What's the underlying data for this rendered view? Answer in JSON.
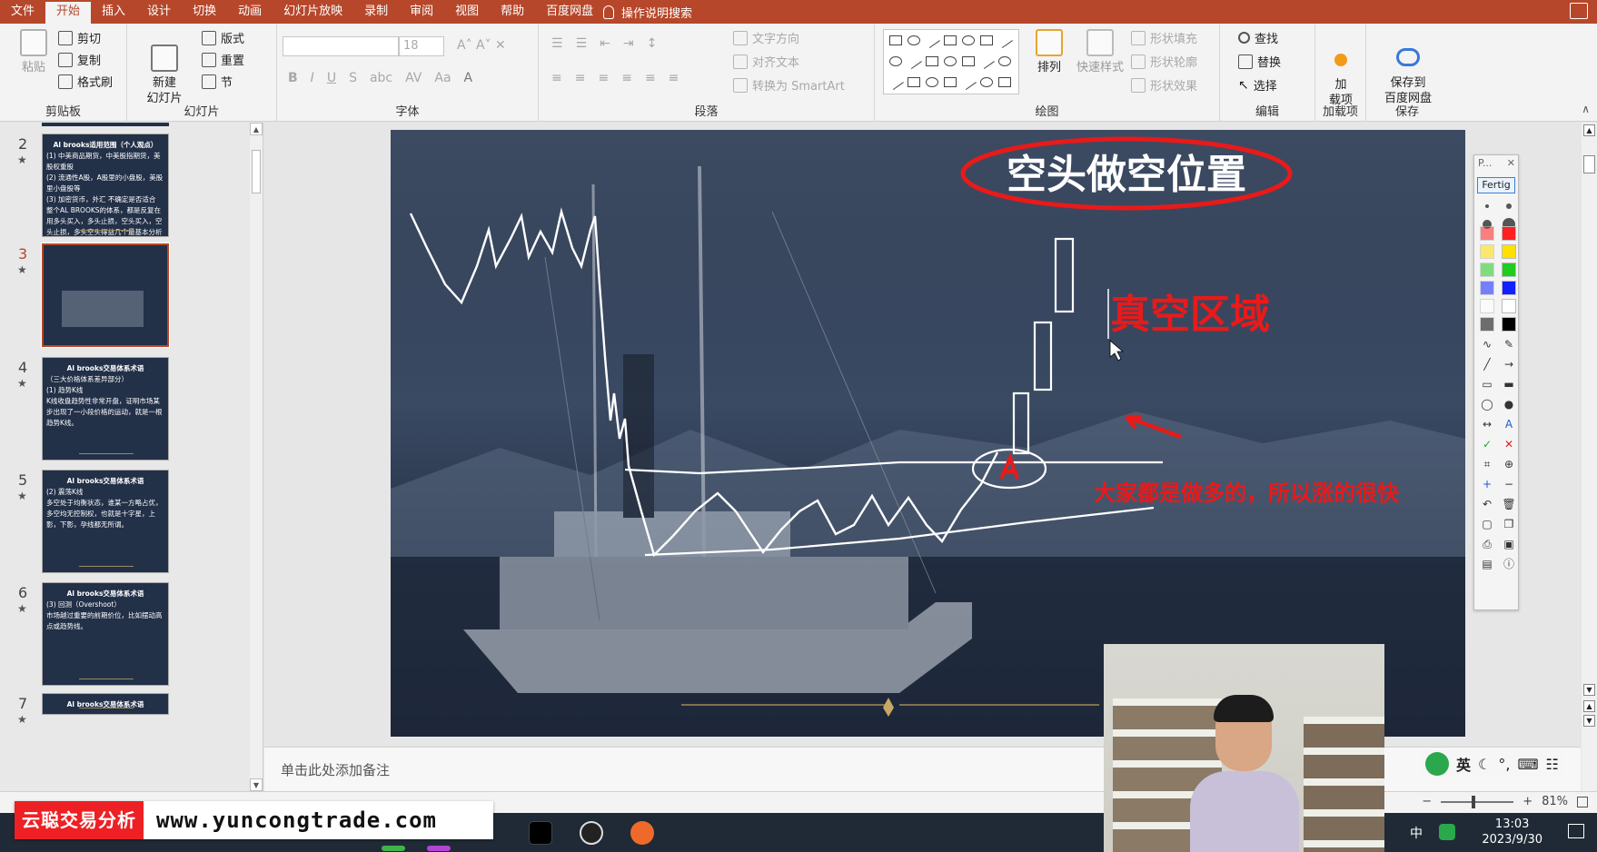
{
  "menu": {
    "tabs": [
      "文件",
      "开始",
      "插入",
      "设计",
      "切换",
      "动画",
      "幻灯片放映",
      "录制",
      "审阅",
      "视图",
      "帮助",
      "百度网盘"
    ],
    "active_tab": "开始",
    "tell_me": "操作说明搜索"
  },
  "ribbon": {
    "clipboard": {
      "paste": "粘贴",
      "cut": "剪切",
      "copy": "复制",
      "format_painter": "格式刷",
      "label": "剪贴板"
    },
    "slides": {
      "new_slide": "新建\n幻灯片",
      "layout": "版式",
      "reset": "重置",
      "section": "节",
      "label": "幻灯片"
    },
    "font": {
      "size": "18",
      "label": "字体"
    },
    "paragraph": {
      "text_direction": "文字方向",
      "align_text": "对齐文本",
      "smartart": "转换为 SmartArt",
      "label": "段落"
    },
    "drawing": {
      "arrange": "排列",
      "quick_styles": "快速样式",
      "shape_fill": "形状填充",
      "shape_outline": "形状轮廓",
      "shape_effects": "形状效果",
      "label": "绘图"
    },
    "editing": {
      "find": "查找",
      "replace": "替换",
      "select": "选择",
      "label": "编辑"
    },
    "addins": {
      "addins": "加\n载项",
      "label": "加载项"
    },
    "save": {
      "baidu": "保存到\n百度网盘",
      "label": "保存"
    }
  },
  "slides": [
    {
      "num": "2",
      "title": "Al brooks适用范围（个人观点）",
      "lines": [
        "(1) 中美商品期货，中美股指期货，美股权重股",
        "(2) 流通性A股，A股里的小盘股，美股里小盘股等",
        "(3) 加密货币，外汇 不确定是否适合",
        "整个AL BROOKS的体系，都是反复在用多头买入，多头止损，空头买入，空头止损，多头空头得益几个最基本分析任何一个市场的多空力量对比。"
      ]
    },
    {
      "num": "3",
      "title": "",
      "lines": []
    },
    {
      "num": "4",
      "title": "Al brooks交易体系术语",
      "lines": [
        "（三大价格体系差异部分）",
        "(1) 趋势K线",
        "K线收盘趋势性非常开盘，证明市场某步出现了一小段价格的运动，就是一根趋势K线。"
      ]
    },
    {
      "num": "5",
      "title": "Al brooks交易体系术语",
      "lines": [
        "(2) 震荡K线",
        "多空处于均衡状态，谁某一方略占优，多空均无控制权，也就是十字星，上影，下影，孕线都无所谓。"
      ]
    },
    {
      "num": "6",
      "title": "Al brooks交易体系术语",
      "lines": [
        "(3) 回测（Overshoot）",
        "市场越过重要的前期价位，比如摆动高点或趋势线。"
      ]
    },
    {
      "num": "7",
      "title": "Al brooks交易体系术语",
      "lines": []
    }
  ],
  "slide_main": {
    "title": "空头做空位置",
    "vacuum_label": "真空区域",
    "annotation": "大家都是做多的，所以涨的很快",
    "colors": {
      "red": "#e81a1a",
      "ink": "#ffffff"
    }
  },
  "notes_placeholder": "单击此处添加备注",
  "ink_panel": {
    "title": "P...",
    "pen": "Fertig"
  },
  "status": {
    "zoom": "81%"
  },
  "banner": {
    "brand": "云聪交易分析",
    "url": "www.yuncongtrade.com"
  },
  "ime": {
    "lang": "英"
  },
  "tray": {
    "ime": "中",
    "time": "13:03",
    "date": "2023/9/30"
  }
}
